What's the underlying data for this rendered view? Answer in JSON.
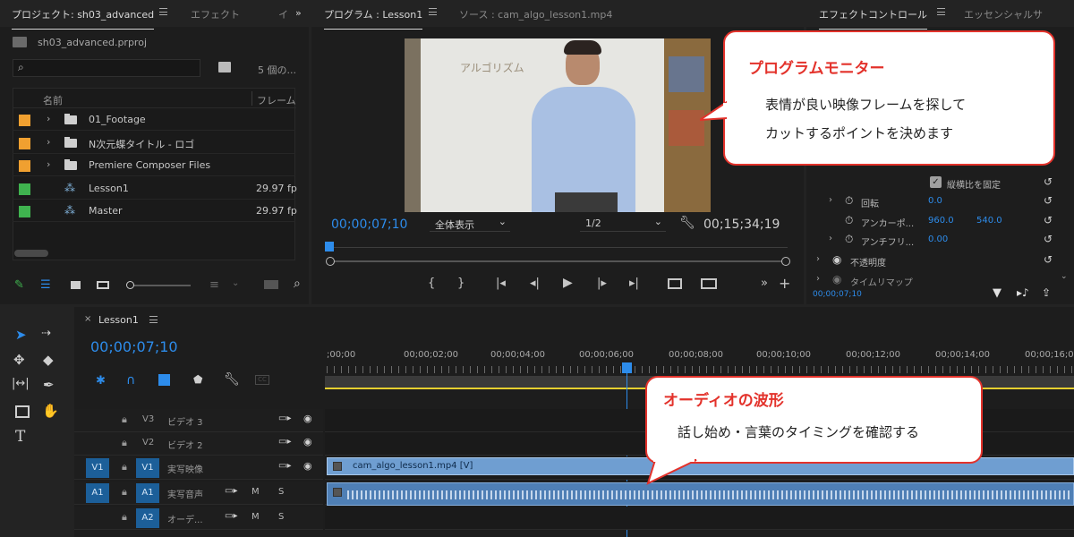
{
  "project": {
    "tab_label": "プロジェクト: sh03_advanced",
    "tab2_label": "エフェクト",
    "tab3_label": "イ",
    "file_name": "sh03_advanced.prproj",
    "item_count": "5 個の...",
    "col_name": "名前",
    "col_frame": "フレーム",
    "items": [
      {
        "name": "01_Footage",
        "frame": "",
        "color": "#f0a030",
        "kind": "folder"
      },
      {
        "name": "N次元蝶タイトル - ロゴ",
        "frame": "",
        "color": "#f0a030",
        "kind": "folder"
      },
      {
        "name": "Premiere Composer Files",
        "frame": "",
        "color": "#f0a030",
        "kind": "folder"
      },
      {
        "name": "Lesson1",
        "frame": "29.97 fp",
        "color": "#3fb34f",
        "kind": "sequence"
      },
      {
        "name": "Master",
        "frame": "29.97 fp",
        "color": "#3fb34f",
        "kind": "sequence"
      }
    ]
  },
  "program": {
    "tab_label": "プログラム : Lesson1",
    "source_tab_label": "ソース : cam_algo_lesson1.mp4",
    "video_board_text": "アルゴリズム",
    "timecode": "00;00;07;10",
    "fit_label": "全体表示",
    "resolution": "1/2",
    "duration": "00;15;34;19"
  },
  "effect_controls": {
    "tab_label": "エフェクトコントロール",
    "tab2_label": "エッセンシャルサ",
    "uniform_scale": "縦横比を固定",
    "rotation_label": "回転",
    "rotation_value": "0.0",
    "anchor_label": "アンカーポ...",
    "anchor_x": "960.0",
    "anchor_y": "540.0",
    "flicker_label": "アンチフリ...",
    "flicker_value": "0.00",
    "opacity_label": "不透明度",
    "remap_label": "タイムリマップ",
    "timecode": "00;00;07;10"
  },
  "timeline": {
    "tab_label": "Lesson1",
    "timecode": "00;00;07;10",
    "ruler": [
      ";00;00",
      "00;00;02;00",
      "00;00;04;00",
      "00;00;06;00",
      "00;00;08;00",
      "00;00;10;00",
      "00;00;12;00",
      "00;00;14;00",
      "00;00;16;00"
    ],
    "tracks": [
      {
        "sel": "",
        "id": "V3",
        "name": "ビデオ 3",
        "kind": "video"
      },
      {
        "sel": "",
        "id": "V2",
        "name": "ビデオ 2",
        "kind": "video"
      },
      {
        "sel": "V1",
        "id": "V1",
        "name": "実写映像",
        "kind": "video"
      },
      {
        "sel": "A1",
        "id": "A1",
        "name": "実写音声",
        "kind": "audio"
      },
      {
        "sel": "",
        "id": "A2",
        "name": "オーデ...",
        "kind": "audio"
      }
    ],
    "mute_label": "M",
    "solo_label": "S",
    "clip_label": "cam_algo_lesson1.mp4 [V]"
  },
  "callouts": {
    "monitor_title": "プログラムモニター",
    "monitor_line1": "表情が良い映像フレームを探して",
    "monitor_line2": "カットするポイントを決めます",
    "audio_title": "オーディオの波形",
    "audio_line1": "話し始め・言葉のタイミングを確認する"
  },
  "colors": {
    "accent": "#2d8ceb",
    "callout_red": "#e3322b",
    "clip_video": "#6f9ed1",
    "clip_audio": "#4f7fb5",
    "work_area": "#e6d02f"
  }
}
